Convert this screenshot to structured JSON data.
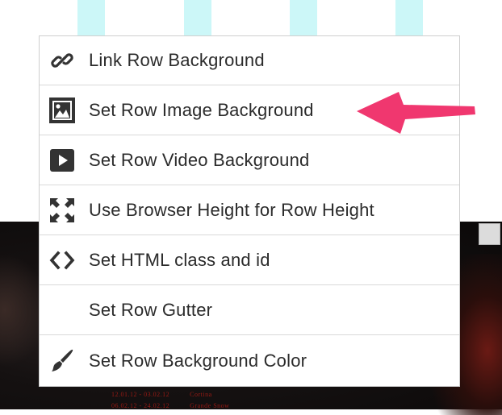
{
  "menu": {
    "items": [
      {
        "label": "Link Row Background",
        "icon": "link-icon"
      },
      {
        "label": "Set Row Image Background",
        "icon": "image-icon"
      },
      {
        "label": "Set Row Video Background",
        "icon": "video-play-icon"
      },
      {
        "label": "Use Browser Height for Row Height",
        "icon": "expand-icon"
      },
      {
        "label": "Set HTML class and id",
        "icon": "code-icon"
      },
      {
        "label": "Set Row Gutter",
        "icon": ""
      },
      {
        "label": "Set Row Background Color",
        "icon": "paintbrush-icon"
      }
    ]
  },
  "background": {
    "poster_lines": [
      "12.01.12 - 03.02.12          Cortina",
      "06.02.12 - 24.02.12          Grande Snow"
    ]
  },
  "colors": {
    "icon": "#333333",
    "text": "#2b2b2b",
    "arrow": "#f0376f",
    "gutter_stripe": "#ccf7f8",
    "menu_border": "#cfcfcf"
  }
}
